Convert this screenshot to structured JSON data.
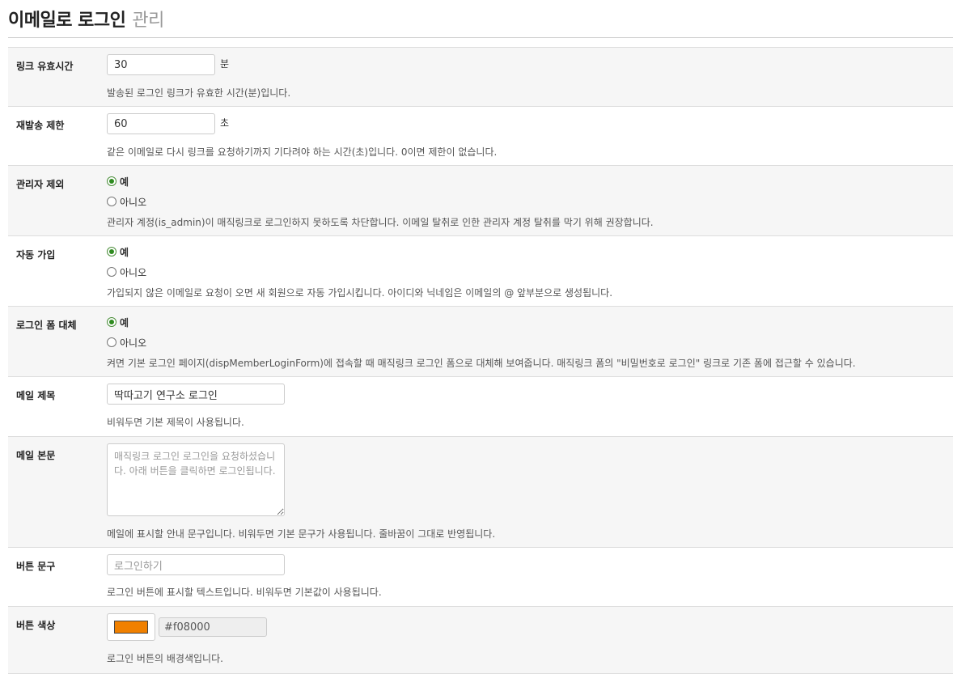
{
  "header": {
    "title": "이메일로 로그인",
    "subtitle": "관리"
  },
  "fields": {
    "link_ttl": {
      "label": "링크 유효시간",
      "value": "30",
      "unit": "분",
      "help": "발송된 로그인 링크가 유효한 시간(분)입니다."
    },
    "resend": {
      "label": "재발송 제한",
      "value": "60",
      "unit": "초",
      "help": "같은 이메일로 다시 링크를 요청하기까지 기다려야 하는 시간(초)입니다. 0이면 제한이 없습니다."
    },
    "exclude_admin": {
      "label": "관리자 제외",
      "yes": "예",
      "no": "아니오",
      "selected": "yes",
      "help": "관리자 계정(is_admin)이 매직링크로 로그인하지 못하도록 차단합니다. 이메일 탈취로 인한 관리자 계정 탈취를 막기 위해 권장합니다."
    },
    "auto_signup": {
      "label": "자동 가입",
      "yes": "예",
      "no": "아니오",
      "selected": "yes",
      "help": "가입되지 않은 이메일로 요청이 오면 새 회원으로 자동 가입시킵니다. 아이디와 닉네임은 이메일의 @ 앞부분으로 생성됩니다."
    },
    "replace_form": {
      "label": "로그인 폼 대체",
      "yes": "예",
      "no": "아니오",
      "selected": "yes",
      "help": "켜면 기본 로그인 페이지(dispMemberLoginForm)에 접속할 때 매직링크 로그인 폼으로 대체해 보여줍니다. 매직링크 폼의 \"비밀번호로 로그인\" 링크로 기존 폼에 접근할 수 있습니다."
    },
    "mail_subject": {
      "label": "메일 제목",
      "value": "딱따고기 연구소 로그인",
      "help": "비워두면 기본 제목이 사용됩니다."
    },
    "mail_body": {
      "label": "메일 본문",
      "placeholder": "매직링크 로그인 로그인을 요청하셨습니다. 아래 버튼을 클릭하면 로그인됩니다.",
      "help": "메일에 표시할 안내 문구입니다. 비워두면 기본 문구가 사용됩니다. 줄바꿈이 그대로 반영됩니다."
    },
    "button_text": {
      "label": "버튼 문구",
      "placeholder": "로그인하기",
      "help": "로그인 버튼에 표시할 텍스트입니다. 비워두면 기본값이 사용됩니다."
    },
    "button_color": {
      "label": "버튼 색상",
      "value": "#f08000",
      "help": "로그인 버튼의 배경색입니다."
    }
  }
}
